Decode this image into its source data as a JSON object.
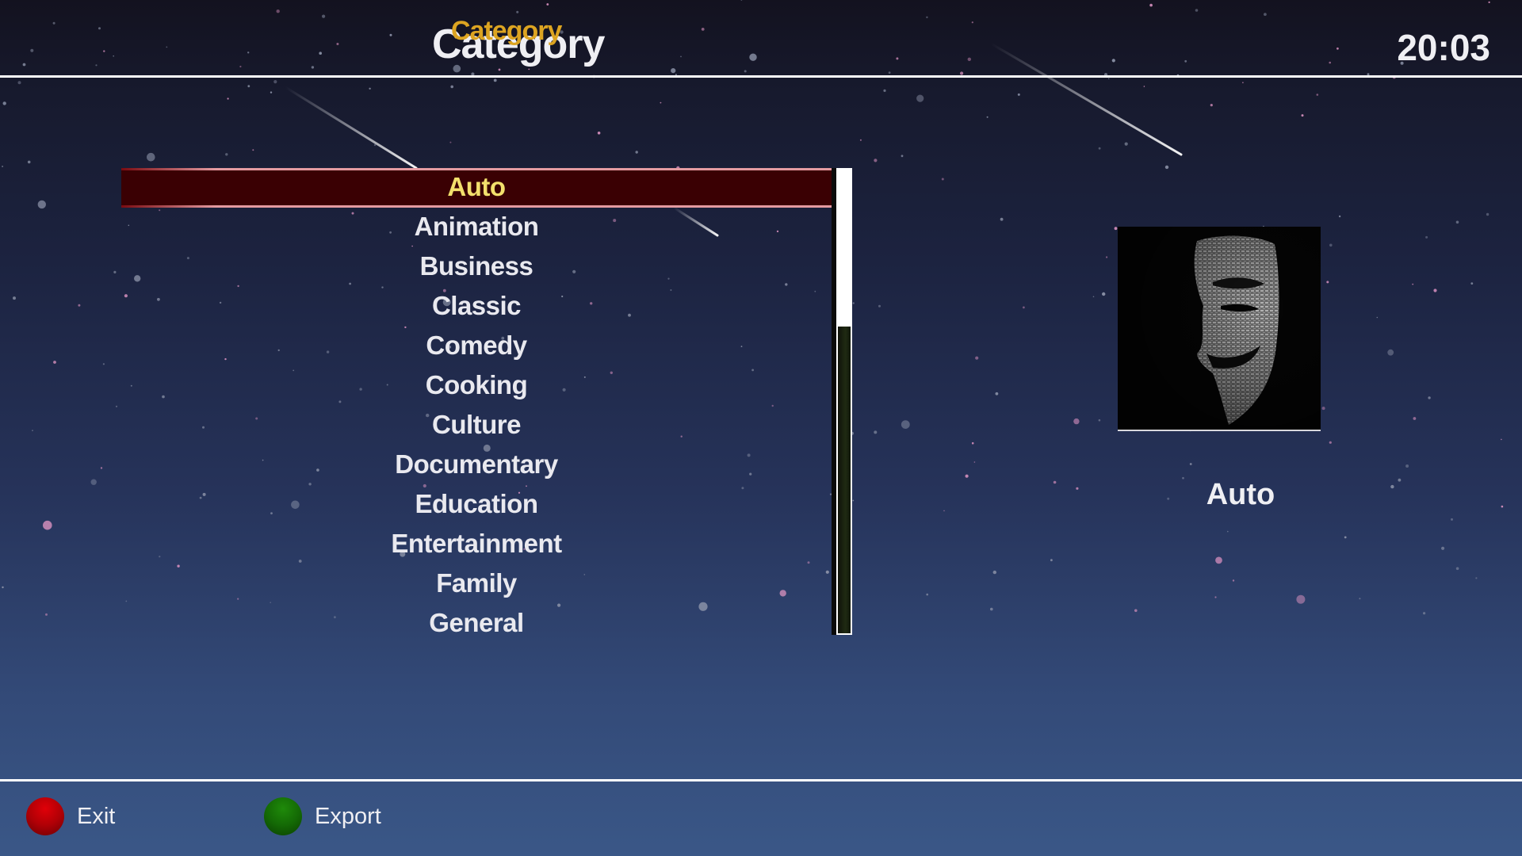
{
  "header": {
    "title": "Category",
    "subtitle": "Category",
    "clock": "20:03"
  },
  "category_list": {
    "selected_index": 0,
    "items": [
      {
        "label": "Auto"
      },
      {
        "label": "Animation"
      },
      {
        "label": "Business"
      },
      {
        "label": "Classic"
      },
      {
        "label": "Comedy"
      },
      {
        "label": "Cooking"
      },
      {
        "label": "Culture"
      },
      {
        "label": "Documentary"
      },
      {
        "label": "Education"
      },
      {
        "label": "Entertainment"
      },
      {
        "label": "Family"
      },
      {
        "label": "General"
      }
    ],
    "scroll_position_fraction": 0,
    "visible_fraction": 0.34
  },
  "preview": {
    "image": "guy-fawkes-mask",
    "label": "Auto"
  },
  "footer": {
    "buttons": [
      {
        "color": "red",
        "label": "Exit"
      },
      {
        "color": "green",
        "label": "Export"
      }
    ]
  },
  "colors": {
    "selected_text": "#f3e06c",
    "selected_background": "#3a0003",
    "title_accent": "#dca421",
    "red_button": "#c00006",
    "green_button": "#186f06"
  }
}
